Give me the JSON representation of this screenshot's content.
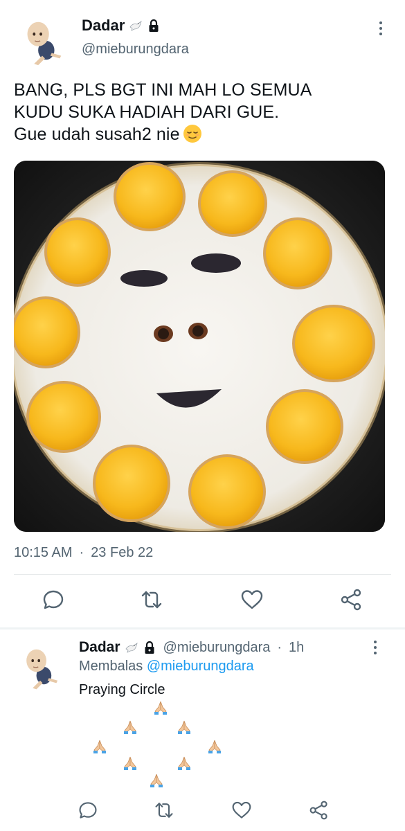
{
  "post": {
    "display_name": "Dadar",
    "verified_icon": "dove-icon",
    "lock_icon": "lock-icon",
    "handle": "@mieburungdara",
    "text_lines": [
      "BANG, PLS BGT INI MAH LO SEMUA",
      "KUDU SUKA HADIAH DARI GUE.",
      "Gue udah susah2 nie"
    ],
    "text_emoji": "relieved-face-emoji",
    "photo_icon": "fried-eggs-smiley-photo",
    "time": "10:15 AM",
    "separator": "·",
    "date": "23 Feb 22"
  },
  "actions": {
    "reply_icon": "reply-icon",
    "retweet_icon": "retweet-icon",
    "like_icon": "heart-icon",
    "share_icon": "share-icon"
  },
  "reply": {
    "display_name": "Dadar",
    "handle": "@mieburungdara",
    "separator": "·",
    "time": "1h",
    "replying_prefix": "Membalas",
    "replying_handle": "@mieburungdara",
    "text": "Praying Circle",
    "emoji_icon": "folded-hands-emoji"
  },
  "colors": {
    "text": "#0f1419",
    "secondary": "#536471",
    "link": "#1d9bf0",
    "divider": "#e6e9ea"
  }
}
